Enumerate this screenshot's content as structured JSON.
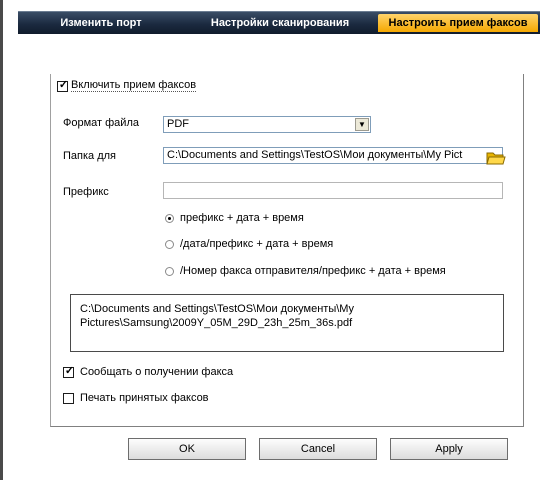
{
  "tabs": [
    {
      "label": "Изменить порт"
    },
    {
      "label": "Настройки сканирования"
    },
    {
      "label": "Настроить прием факсов"
    }
  ],
  "enable_fax": {
    "label": "Включить прием факсов",
    "checked": true
  },
  "file_format": {
    "label": "Формат файла",
    "value": "PDF"
  },
  "folder": {
    "label": "Папка для",
    "value": "C:\\Documents and Settings\\TestOS\\Мои документы\\My Pict"
  },
  "prefix": {
    "label": "Префикс",
    "value": ""
  },
  "radio_options": [
    {
      "label": "префикс + дата + время",
      "selected": true
    },
    {
      "label": "/дата/префикс + дата + время",
      "selected": false
    },
    {
      "label": "/Номер факса отправителя/префикс + дата + время",
      "selected": false
    }
  ],
  "path_preview": {
    "line1": "C:\\Documents and Settings\\TestOS\\Мои документы\\My",
    "line2": "Pictures\\Samsung\\2009Y_05M_29D_23h_25m_36s.pdf"
  },
  "notify": {
    "label": "Сообщать о получении факса",
    "checked": true
  },
  "print": {
    "label": "Печать принятых факсов",
    "checked": false
  },
  "buttons": {
    "ok": "OK",
    "cancel": "Cancel",
    "apply": "Apply"
  },
  "colors": {
    "tab_bar": "#1b2a40",
    "active_tab": "#f5a800",
    "folder_icon": "#f2c200"
  }
}
